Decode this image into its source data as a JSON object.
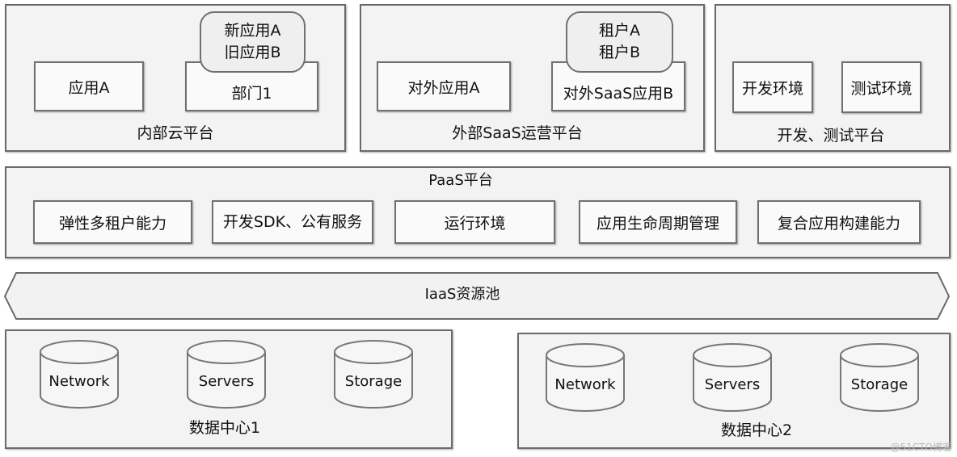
{
  "internal": {
    "title": "内部云平台",
    "app_a": "应用A",
    "dept": "部门1",
    "dept_apps": [
      "新应用A",
      "旧应用B"
    ]
  },
  "saas": {
    "title": "外部SaaS运营平台",
    "app_a": "对外应用A",
    "app_b": "对外SaaS应用B",
    "tenants": [
      "租户A",
      "租户B"
    ]
  },
  "devtest": {
    "title": "开发、测试平台",
    "dev": "开发环境",
    "test": "测试环境"
  },
  "paas": {
    "title": "PaaS平台",
    "items": [
      "弹性多租户能力",
      "开发SDK、公有服务",
      "运行环境",
      "应用生命周期管理",
      "复合应用构建能力"
    ]
  },
  "iaas": {
    "title": "IaaS资源池"
  },
  "dc1": {
    "title": "数据中心1",
    "items": [
      "Network",
      "Servers",
      "Storage"
    ]
  },
  "dc2": {
    "title": "数据中心2",
    "items": [
      "Network",
      "Servers",
      "Storage"
    ]
  },
  "watermark": "@51CTO博客"
}
